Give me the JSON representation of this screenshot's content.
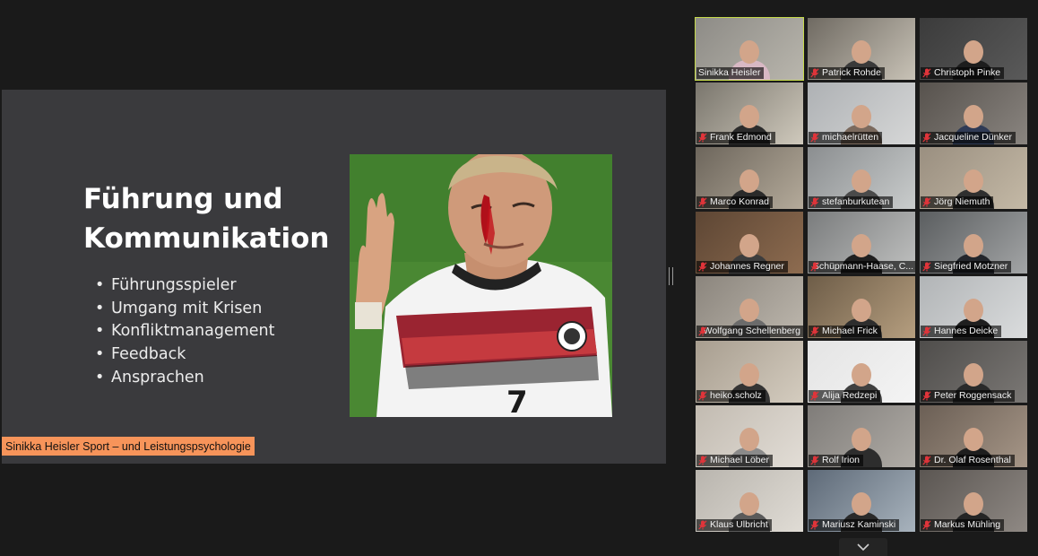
{
  "slide": {
    "title_line1": "Führung und",
    "title_line2": "Kommunikation",
    "bullets": [
      "Führungsspieler",
      "Umgang mit Krisen",
      "Konfliktmanagement",
      "Feedback",
      "Ansprachen"
    ],
    "footer": "Sinikka Heisler Sport – und Leistungspsychologie"
  },
  "participants": [
    {
      "name": "Sinikka Heisler",
      "muted": false,
      "active": true
    },
    {
      "name": "Patrick Rohde",
      "muted": true
    },
    {
      "name": "Christoph Pinke",
      "muted": true
    },
    {
      "name": "Frank Edmond",
      "muted": true
    },
    {
      "name": "michaelrütten",
      "muted": true
    },
    {
      "name": "Jacqueline Dünker",
      "muted": true
    },
    {
      "name": "Marco Konrad",
      "muted": true
    },
    {
      "name": "stefanburkutean",
      "muted": true
    },
    {
      "name": "Jörg Niemuth",
      "muted": true
    },
    {
      "name": "Johannes Regner",
      "muted": true
    },
    {
      "name": "Schüpmann-Haase, C...",
      "muted": true
    },
    {
      "name": "Siegfried Motzner",
      "muted": true
    },
    {
      "name": "Wolfgang Schellenberg",
      "muted": true
    },
    {
      "name": "Michael Frick",
      "muted": true
    },
    {
      "name": "Hannes Deicke",
      "muted": true
    },
    {
      "name": "heiko.scholz",
      "muted": true
    },
    {
      "name": "Alija Redzepi",
      "muted": true
    },
    {
      "name": "Peter Roggensack",
      "muted": true
    },
    {
      "name": "Michael Löber",
      "muted": true
    },
    {
      "name": "Rolf Irion",
      "muted": true
    },
    {
      "name": "Dr. Olaf Rosenthal",
      "muted": true
    },
    {
      "name": "Klaus Ulbricht",
      "muted": true
    },
    {
      "name": "Mariusz Kaminski",
      "muted": true
    },
    {
      "name": "Markus Mühling",
      "muted": true
    }
  ],
  "colors": {
    "accent_active": "#c5d94a",
    "muted_mic": "#e0343a",
    "footer_bg": "#f7945a",
    "slide_bg": "#3a3a3d"
  }
}
